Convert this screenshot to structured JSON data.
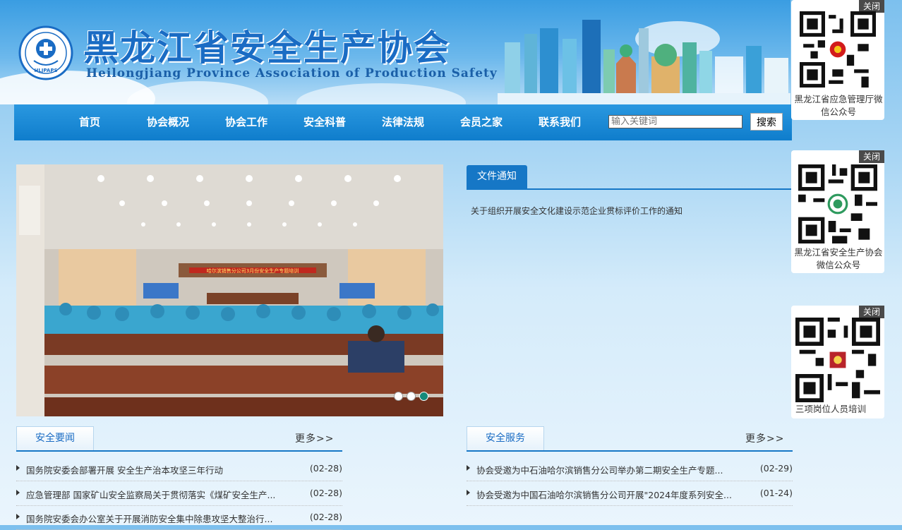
{
  "header": {
    "title": "黑龙江省安全生产协会",
    "subtitle": "Heilongjiang Province Association of Production Safety",
    "logo_text": "HLJPAPS"
  },
  "nav": {
    "items": [
      "首页",
      "协会概况",
      "协会工作",
      "安全科普",
      "法律法规",
      "会员之家",
      "联系我们"
    ],
    "search_placeholder": "输入关键词",
    "search_button": "搜索"
  },
  "slider": {
    "banner_text": "哈尔滨销售分公司3月份安全生产专题培训",
    "dots": 3,
    "active_dot": 3
  },
  "notices": {
    "tab": "文件通知",
    "items": [
      "关于组织开展安全文化建设示范企业贯标评价工作的通知"
    ]
  },
  "qr_panels": [
    {
      "close": "关闭",
      "caption": "黑龙江省应急管理厅微信公众号"
    },
    {
      "close": "关闭",
      "caption": "黑龙江省安全生产协会微信公众号"
    },
    {
      "close": "关闭",
      "caption": "三项岗位人员培训"
    }
  ],
  "safety_news": {
    "tab": "安全要闻",
    "more": "更多>>",
    "items": [
      {
        "title": "国务院安委会部署开展 安全生产治本攻坚三年行动",
        "date": "(02-28)"
      },
      {
        "title": "应急管理部 国家矿山安全监察局关于贯彻落实《煤矿安全生产...",
        "date": "(02-28)"
      },
      {
        "title": "国务院安委会办公室关于开展消防安全集中除患攻坚大整治行...",
        "date": "(02-28)"
      }
    ]
  },
  "safety_service": {
    "tab": "安全服务",
    "more": "更多>>",
    "items": [
      {
        "title": "协会受邀为中石油哈尔滨销售分公司举办第二期安全生产专题...",
        "date": "(02-29)"
      },
      {
        "title": "协会受邀为中国石油哈尔滨销售分公司开展\"2024年度系列安全...",
        "date": "(01-24)"
      }
    ]
  },
  "colors": {
    "primary": "#1677c6",
    "nav": "#0f7dcc",
    "title": "#1a6cc4"
  }
}
